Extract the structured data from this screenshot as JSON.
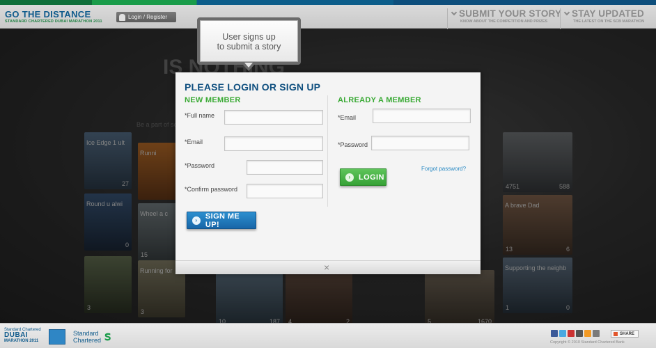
{
  "header": {
    "brand_title": "GO THE DISTANCE",
    "brand_subtitle": "STANDARD CHARTERED DUBAI MARATHON 2011",
    "login_label": "Login / Register",
    "nav": [
      {
        "title": "SUBMIT YOUR STORY",
        "subtitle": "KNOW ABOUT THE COMPETITION AND PRIZES"
      },
      {
        "title": "STAY UPDATED",
        "subtitle": "THE LATEST ON THE SCB MARATHON"
      }
    ]
  },
  "background": {
    "headline": "IS NOTHING",
    "small_text": "Be a part of sc",
    "tiles": [
      {
        "caption": "Ice Edge 1 ult",
        "count": "27",
        "likes": ""
      },
      {
        "caption": "Runni",
        "count": "",
        "likes": ""
      },
      {
        "caption": "Round u alwi",
        "count": "0",
        "likes": ""
      },
      {
        "caption": "Wheel a c",
        "count": "",
        "likes": "15"
      },
      {
        "caption": "",
        "count": "",
        "likes": "3"
      },
      {
        "caption": "Running for",
        "count": "",
        "likes": "3"
      },
      {
        "caption": "",
        "count": "187",
        "likes": "10"
      },
      {
        "caption": "",
        "count": "2",
        "likes": "4"
      },
      {
        "caption": "",
        "count": "1670",
        "likes": "5"
      },
      {
        "caption": "",
        "count": "588",
        "likes": "4751"
      },
      {
        "caption": "A brave Dad",
        "count": "6",
        "likes": "13"
      },
      {
        "caption": "Supporting the neighb",
        "count": "0",
        "likes": "1"
      }
    ]
  },
  "callout": {
    "text_line1": "User signs up",
    "text_line2": "to submit a story"
  },
  "modal": {
    "title": "PLEASE LOGIN OR SIGN UP",
    "new_member": {
      "heading": "NEW MEMBER",
      "full_name_label": "*Full name",
      "email_label": "*Email",
      "password_label": "*Password",
      "confirm_label": "*Confirm password",
      "submit_label": "SIGN ME UP!"
    },
    "member": {
      "heading": "ALREADY A MEMBER",
      "email_label": "*Email",
      "password_label": "*Password",
      "login_label": "LOGIN",
      "forgot_label": "Forgot password?"
    },
    "close_glyph": "×"
  },
  "footer": {
    "logo_line1": "Standard Chartered",
    "logo_line2": "DUBAI",
    "logo_line3": "MARATHON 2011",
    "sc_line1": "Standard",
    "sc_line2": "Chartered",
    "share_label": "SHARE",
    "copyright": "Copyright © 2010 Standard Chartered Bank"
  },
  "colors": {
    "brand_blue": "#0f5b8c",
    "brand_green": "#3aaa35",
    "link_blue": "#2a8ac4"
  }
}
